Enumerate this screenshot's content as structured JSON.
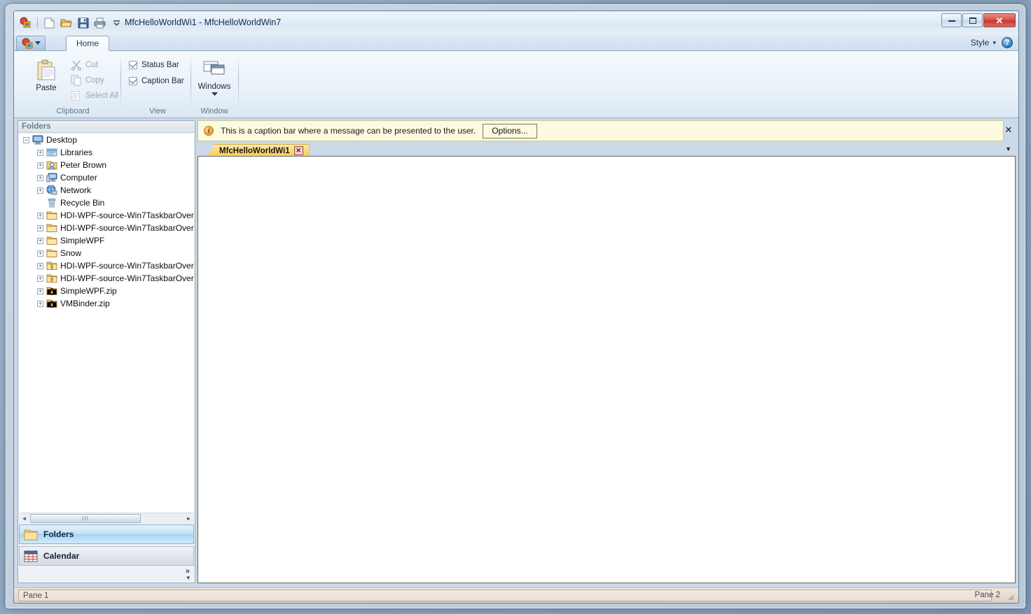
{
  "window": {
    "title": "MfcHelloWorldWi1 - MfcHelloWorldWin7",
    "minimize_label": "Minimize",
    "maximize_label": "Restore",
    "close_label": "Close"
  },
  "quick_access": {
    "items": [
      {
        "name": "app-logo-icon",
        "label": "Application"
      },
      {
        "name": "new-icon",
        "label": "New"
      },
      {
        "name": "open-icon",
        "label": "Open"
      },
      {
        "name": "save-icon",
        "label": "Save"
      },
      {
        "name": "print-icon",
        "label": "Print"
      },
      {
        "name": "customize-chevron-icon",
        "label": "Customize Quick Access Toolbar"
      }
    ]
  },
  "ribbon": {
    "app_button_label": "File",
    "tabs": [
      {
        "label": "Home",
        "active": true
      }
    ],
    "style_menu": {
      "label": "Style",
      "chevron": "▾"
    },
    "help_label": "?",
    "groups": [
      {
        "name": "clipboard",
        "label": "Clipboard",
        "big_button": {
          "label": "Paste",
          "enabled": true
        },
        "small_buttons": [
          {
            "label": "Cut",
            "icon": "scissors-icon",
            "enabled": false
          },
          {
            "label": "Copy",
            "icon": "copy-icon",
            "enabled": false
          },
          {
            "label": "Select All",
            "icon": "select-all-icon",
            "enabled": false
          }
        ]
      },
      {
        "name": "view",
        "label": "View",
        "checkboxes": [
          {
            "label": "Status Bar",
            "checked": true
          },
          {
            "label": "Caption Bar",
            "checked": true
          }
        ]
      },
      {
        "name": "window",
        "label": "Window",
        "big_button": {
          "label": "Windows",
          "enabled": true,
          "has_dropdown": true
        }
      }
    ]
  },
  "left_pane": {
    "caption": "Folders",
    "tree": [
      {
        "label": "Desktop",
        "indent": 0,
        "expander": "minus",
        "icon": "desktop-icon"
      },
      {
        "label": "Libraries",
        "indent": 1,
        "expander": "plus",
        "icon": "libraries-icon"
      },
      {
        "label": "Peter Brown",
        "indent": 1,
        "expander": "plus",
        "icon": "user-icon"
      },
      {
        "label": "Computer",
        "indent": 1,
        "expander": "plus",
        "icon": "computer-icon"
      },
      {
        "label": "Network",
        "indent": 1,
        "expander": "plus",
        "icon": "network-icon"
      },
      {
        "label": "Recycle Bin",
        "indent": 1,
        "expander": "none",
        "icon": "recycle-bin-icon"
      },
      {
        "label": "HDI-WPF-source-Win7TaskbarOver",
        "indent": 1,
        "expander": "plus",
        "icon": "folder-icon"
      },
      {
        "label": "HDI-WPF-source-Win7TaskbarOver",
        "indent": 1,
        "expander": "plus",
        "icon": "folder-icon"
      },
      {
        "label": "SimpleWPF",
        "indent": 1,
        "expander": "plus",
        "icon": "folder-icon"
      },
      {
        "label": "Snow",
        "indent": 1,
        "expander": "plus",
        "icon": "folder-icon"
      },
      {
        "label": "HDI-WPF-source-Win7TaskbarOver",
        "indent": 1,
        "expander": "plus",
        "icon": "zip-folder-icon"
      },
      {
        "label": "HDI-WPF-source-Win7TaskbarOver",
        "indent": 1,
        "expander": "plus",
        "icon": "zip-folder-icon"
      },
      {
        "label": "SimpleWPF.zip",
        "indent": 1,
        "expander": "plus",
        "icon": "zip-icon"
      },
      {
        "label": "VMBinder.zip",
        "indent": 1,
        "expander": "plus",
        "icon": "zip-icon"
      }
    ],
    "scroll": {
      "left_arrow": "◄",
      "right_arrow": "►",
      "thumb_grip": "III"
    },
    "dock_buttons": [
      {
        "label": "Folders",
        "icon": "folder-icon",
        "selected": true
      },
      {
        "label": "Calendar",
        "icon": "calendar-icon",
        "selected": false
      }
    ],
    "more_chevron": "»",
    "more_dropdown": "▾"
  },
  "caption_bar": {
    "icon": "info-icon",
    "message": "This is a caption bar where a message can be presented to the user.",
    "button_label": "Options...",
    "close_label": "✕"
  },
  "document": {
    "tab_label": "MfcHelloWorldWi1",
    "tab_close": "✕",
    "tabbar_dropdown": "▼",
    "content": ""
  },
  "status_bar": {
    "pane1": "Pane 1",
    "pane2": "Pane 2"
  }
}
